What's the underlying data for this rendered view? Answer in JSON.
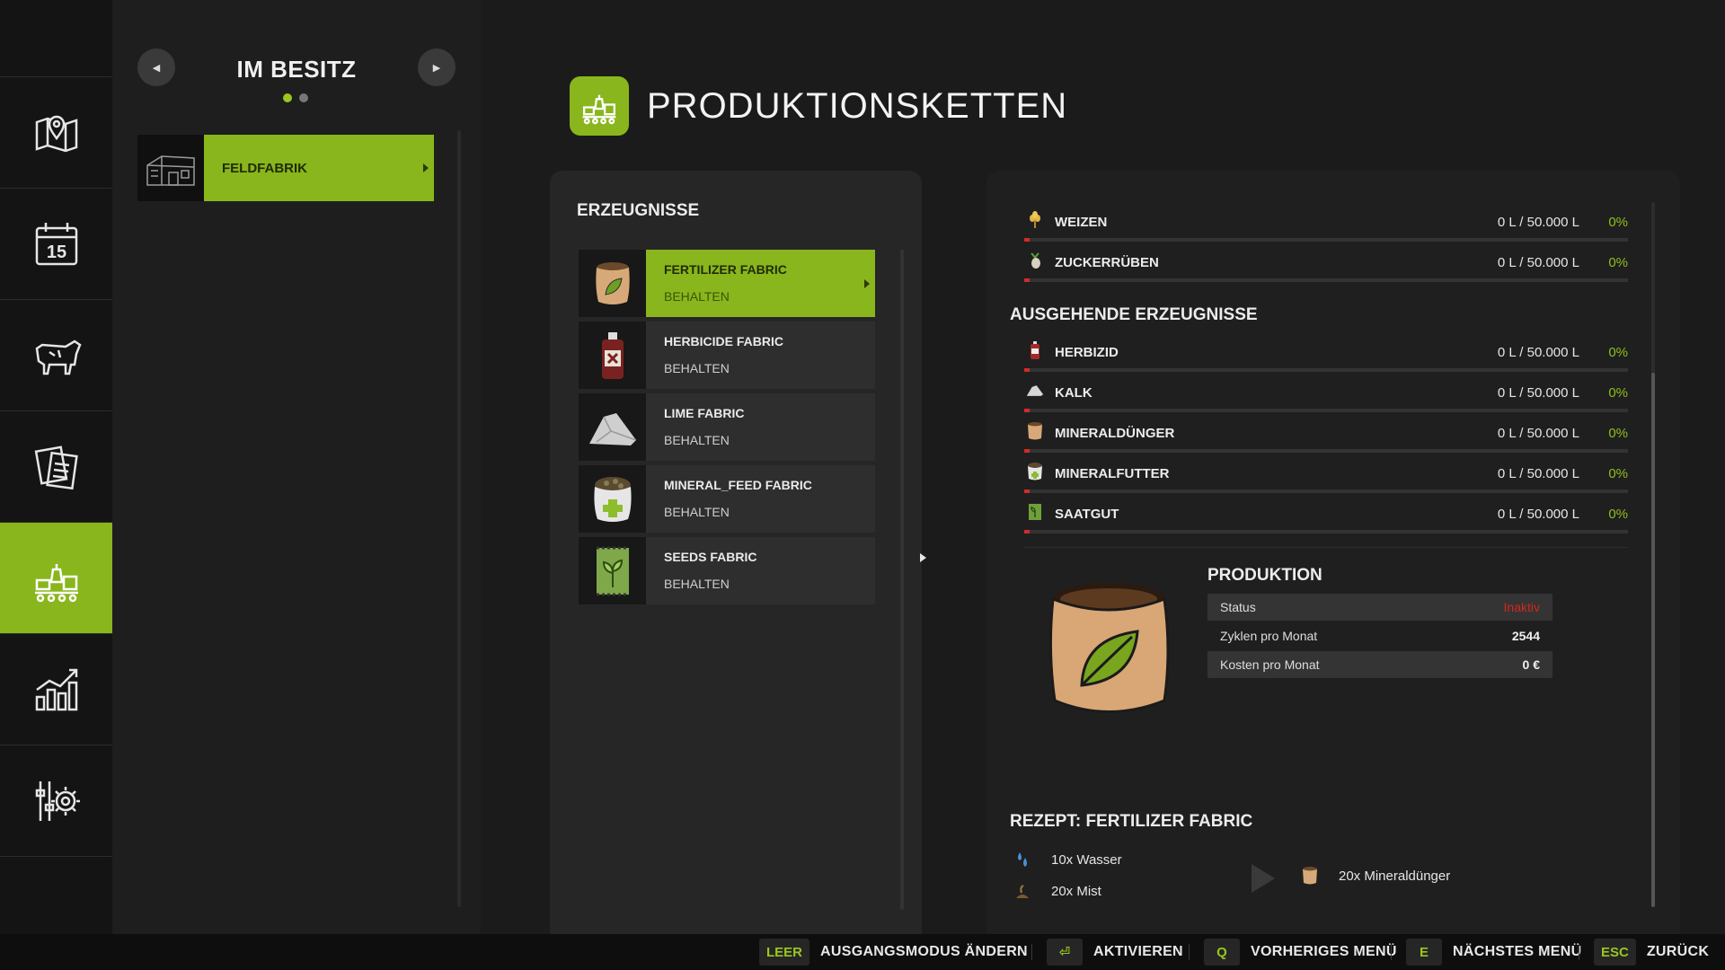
{
  "colors": {
    "accent": "#89b61c",
    "accent_text": "#8fbf1d",
    "warning_red": "#d2261f",
    "background": "#1b1b1b"
  },
  "nav": {
    "items": [
      {
        "name": "map",
        "icon": "map-pin-icon"
      },
      {
        "name": "calendar",
        "icon": "calendar-icon",
        "label": "15"
      },
      {
        "name": "animals",
        "icon": "cow-icon"
      },
      {
        "name": "contracts",
        "icon": "documents-icon"
      },
      {
        "name": "production",
        "icon": "production-chain-icon",
        "active": true
      },
      {
        "name": "statistics",
        "icon": "bar-chart-icon"
      },
      {
        "name": "settings",
        "icon": "settings-sliders-icon"
      }
    ]
  },
  "owned": {
    "title": "IM BESITZ",
    "prev_icon": "chevron-left-icon",
    "next_icon": "chevron-right-icon",
    "page_dots": [
      true,
      false
    ],
    "items": [
      {
        "label": "FELDFABRIK",
        "selected": true
      }
    ]
  },
  "header": {
    "title": "PRODUKTIONSKETTEN",
    "icon": "production-chain-icon"
  },
  "products": {
    "title": "ERZEUGNISSE",
    "items": [
      {
        "name": "FERTILIZER FABRIC",
        "mode": "BEHALTEN",
        "icon": "fertilizer-sack-icon",
        "selected": true
      },
      {
        "name": "HERBICIDE FABRIC",
        "mode": "BEHALTEN",
        "icon": "herbicide-bottle-icon",
        "selected": false
      },
      {
        "name": "LIME FABRIC",
        "mode": "BEHALTEN",
        "icon": "lime-pile-icon",
        "selected": false
      },
      {
        "name": "MINERAL_FEED FABRIC",
        "mode": "BEHALTEN",
        "icon": "mineral-feed-sack-icon",
        "selected": false
      },
      {
        "name": "SEEDS FABRIC",
        "mode": "BEHALTEN",
        "icon": "seeds-bag-icon",
        "selected": false
      }
    ]
  },
  "inputs": [
    {
      "name": "WEIZEN",
      "amount": "0 L / 50.000 L",
      "percent": "0%",
      "fill": 0,
      "icon": "wheat-icon"
    },
    {
      "name": "ZUCKERRÜBEN",
      "amount": "0 L / 50.000 L",
      "percent": "0%",
      "fill": 0,
      "icon": "sugarbeet-icon"
    }
  ],
  "outputs": {
    "title": "AUSGEHENDE ERZEUGNISSE",
    "items": [
      {
        "name": "HERBIZID",
        "amount": "0 L / 50.000 L",
        "percent": "0%",
        "fill": 0,
        "icon": "herbicide-icon"
      },
      {
        "name": "KALK",
        "amount": "0 L / 50.000 L",
        "percent": "0%",
        "fill": 0,
        "icon": "lime-icon"
      },
      {
        "name": "MINERALDÜNGER",
        "amount": "0 L / 50.000 L",
        "percent": "0%",
        "fill": 0,
        "icon": "fertilizer-icon"
      },
      {
        "name": "MINERALFUTTER",
        "amount": "0 L / 50.000 L",
        "percent": "0%",
        "fill": 0,
        "icon": "mineral-feed-icon"
      },
      {
        "name": "SAATGUT",
        "amount": "0 L / 50.000 L",
        "percent": "0%",
        "fill": 0,
        "icon": "seeds-icon"
      }
    ]
  },
  "production": {
    "title": "PRODUKTION",
    "image_icon": "fertilizer-sack-icon",
    "rows": [
      {
        "label": "Status",
        "value": "Inaktiv"
      },
      {
        "label": "Zyklen pro Monat",
        "value": "2544"
      },
      {
        "label": "Kosten pro Monat",
        "value": "0 €"
      }
    ]
  },
  "recipe": {
    "title": "REZEPT: FERTILIZER FABRIC",
    "inputs": [
      {
        "label": "10x Wasser",
        "icon": "water-drops-icon"
      },
      {
        "label": "20x Mist",
        "icon": "manure-icon"
      }
    ],
    "arrow_icon": "play-arrow-icon",
    "output": {
      "label": "20x Mineraldünger",
      "icon": "fertilizer-icon"
    }
  },
  "bottom_bar": {
    "hints": [
      {
        "key": "LEER",
        "label": "AUSGANGSMODUS ÄNDERN"
      },
      {
        "key": "⏎",
        "label": "AKTIVIEREN"
      },
      {
        "key": "Q",
        "label": "VORHERIGES MENÜ"
      },
      {
        "key": "E",
        "label": "NÄCHSTES MENÜ"
      },
      {
        "key": "ESC",
        "label": "ZURÜCK"
      }
    ]
  }
}
